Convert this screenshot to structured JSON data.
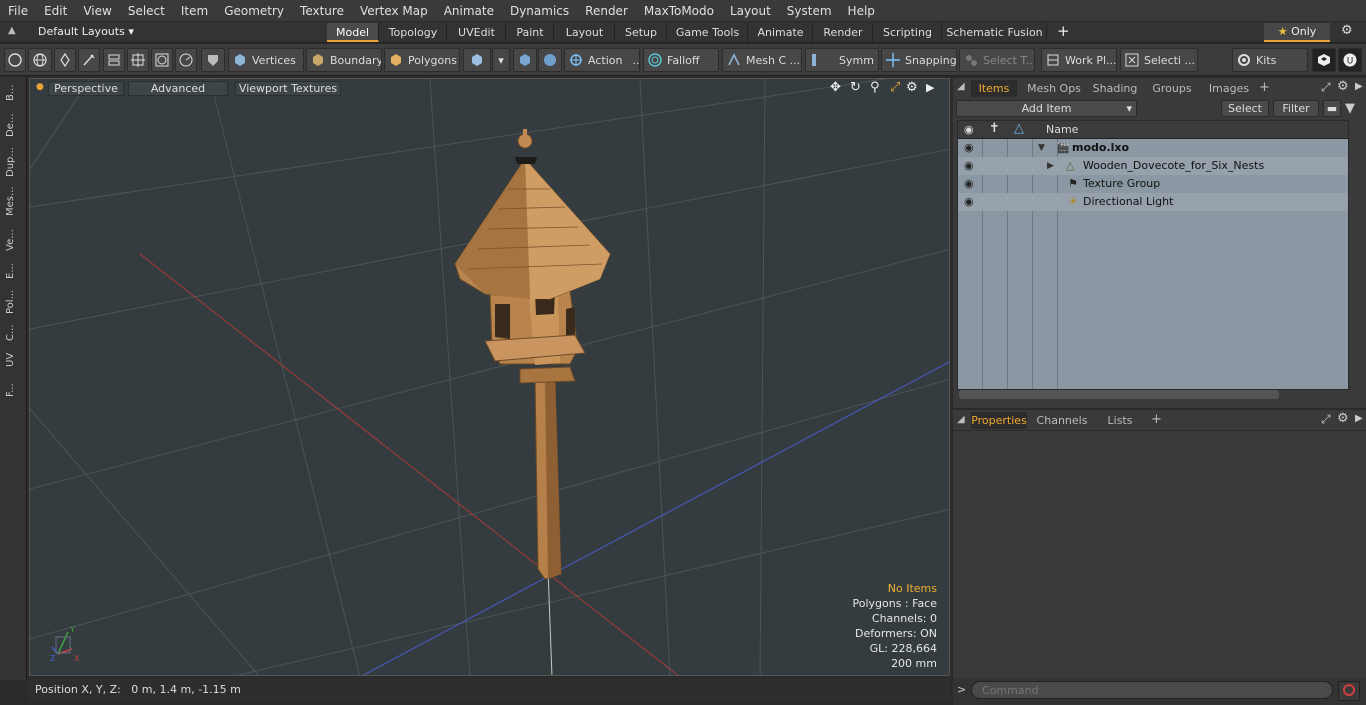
{
  "menu": [
    "File",
    "Edit",
    "View",
    "Select",
    "Item",
    "Geometry",
    "Texture",
    "Vertex Map",
    "Animate",
    "Dynamics",
    "Render",
    "MaxToModo",
    "Layout",
    "System",
    "Help"
  ],
  "layout": {
    "preset": "Default Layouts",
    "tabs": [
      "Model",
      "Topology",
      "UVEdit",
      "Paint",
      "Layout",
      "Setup",
      "Game Tools",
      "Animate",
      "Render",
      "Scripting",
      "Schematic Fusion"
    ],
    "active_tab": "Model",
    "only_label": "Only"
  },
  "toolbar": {
    "vertices": "Vertices",
    "boundary": "Boundary",
    "polygons": "Polygons",
    "action": "Action",
    "falloff": "Falloff",
    "mesh": "Mesh C ...",
    "symm": "Symm ...",
    "snapping": "Snapping",
    "select_t": "Select T...",
    "work_pl": "Work Pl...",
    "selecti": "Selecti ...",
    "kits": "Kits"
  },
  "left_tabs": [
    "B...",
    "De...",
    "Dup...",
    "Mes...",
    "Ve...",
    "E...",
    "Pol...",
    "C...",
    "UV",
    "F..."
  ],
  "viewport": {
    "view": "Perspective",
    "advanced": "Advanced",
    "textures": "Viewport Textures",
    "stats": {
      "items": "No Items",
      "polygons": "Polygons : Face",
      "channels": "Channels: 0",
      "deformers": "Deformers: ON",
      "gl": "GL: 228,664",
      "scale": "200 mm"
    },
    "axes": {
      "x": "X",
      "y": "Y",
      "z": "Z"
    }
  },
  "status": {
    "position": "Position X, Y, Z:   0 m, 1.4 m, -1.15 m"
  },
  "items_panel": {
    "tabs": [
      "Items",
      "Mesh Ops",
      "Shading",
      "Groups",
      "Images"
    ],
    "active_tab": "Items",
    "add_item": "Add Item",
    "select": "Select",
    "filter": "Filter",
    "column_name": "Name",
    "tree": [
      {
        "label": "modo.lxo",
        "level": 0,
        "bold": true
      },
      {
        "label": "Wooden_Dovecote_for_Six_Nests",
        "level": 1,
        "bold": false
      },
      {
        "label": "Texture Group",
        "level": 1,
        "bold": false
      },
      {
        "label": "Directional Light",
        "level": 1,
        "bold": false
      }
    ]
  },
  "properties_panel": {
    "tabs": [
      "Properties",
      "Channels",
      "Lists"
    ],
    "active_tab": "Properties"
  },
  "command": {
    "placeholder": "Command"
  },
  "colors": {
    "accent": "#e8a33a",
    "viewport_bg": "#343c40",
    "tree_bg": "#8b97a2",
    "wood": "#b07a45"
  }
}
